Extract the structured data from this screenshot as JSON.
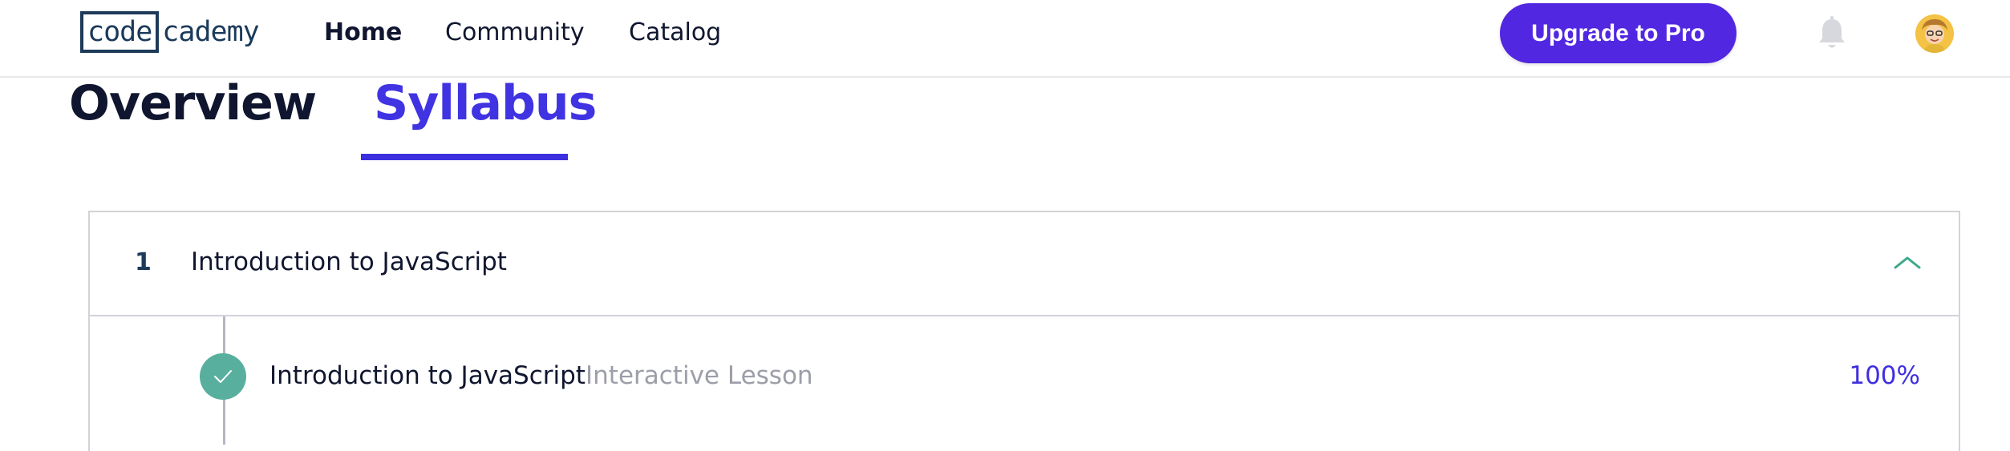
{
  "brand": {
    "logo_boxed": "code",
    "logo_rest": "cademy"
  },
  "nav": {
    "links": [
      {
        "label": "Home",
        "active": true
      },
      {
        "label": "Community",
        "active": false
      },
      {
        "label": "Catalog",
        "active": false
      }
    ],
    "upgrade_label": "Upgrade to Pro",
    "icons": {
      "notifications": "bell-icon",
      "profile": "avatar"
    }
  },
  "tabs": [
    {
      "label": "Overview",
      "selected": false
    },
    {
      "label": "Syllabus",
      "selected": true
    }
  ],
  "syllabus": {
    "module": {
      "number": "1",
      "title": "Introduction to JavaScript",
      "expanded": true,
      "lessons": [
        {
          "title": "Introduction to JavaScript",
          "type": "Interactive Lesson",
          "progress": "100%",
          "completed": true
        }
      ]
    }
  },
  "colors": {
    "accent": "#5127e1",
    "tab_active": "#4033e2",
    "success": "#59af9d",
    "chevron": "#3ba88a",
    "muted_text": "#9c9ea8",
    "navy": "#1c3a5a"
  }
}
